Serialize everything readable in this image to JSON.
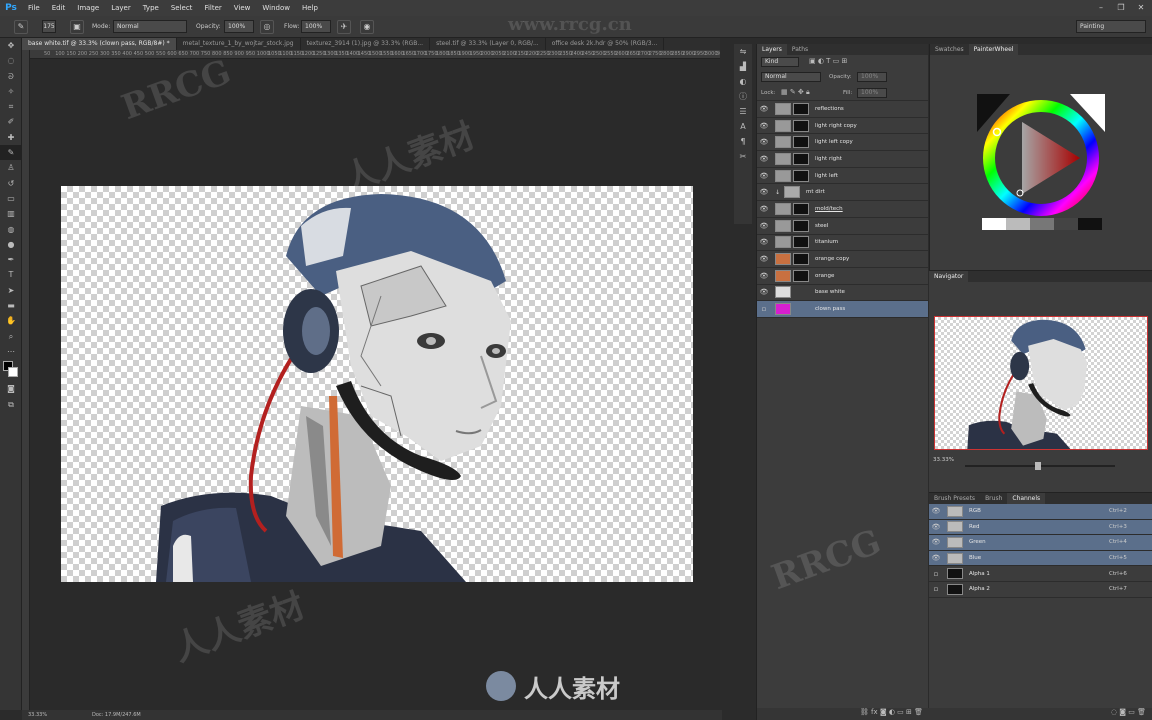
{
  "app": {
    "logo": "Ps"
  },
  "menu": [
    "File",
    "Edit",
    "Image",
    "Layer",
    "Type",
    "Select",
    "Filter",
    "View",
    "Window",
    "Help"
  ],
  "window_controls": [
    "–",
    "❐",
    "✕"
  ],
  "workspace": "Painting",
  "options": {
    "brush_size": "175",
    "mode_label": "Mode:",
    "mode_value": "Normal",
    "opacity_label": "Opacity:",
    "opacity_value": "100%",
    "flow_label": "Flow:",
    "flow_value": "100%"
  },
  "doc_tabs": [
    "base white.tif @ 33.3% (clown pass, RGB/8#) *",
    "metal_texture_1_by_wojtar_stock.jpg",
    "texturez_3914 (1).jpg @ 33.3% (RGB...",
    "steel.tif @ 33.3% (Layer 0, RGB/...",
    "office desk 2k.hdr @ 50% (RGB/3..."
  ],
  "ruler_ticks": [
    "50",
    "100",
    "150",
    "200",
    "250",
    "300",
    "350",
    "400",
    "450",
    "500",
    "550",
    "600",
    "650",
    "700",
    "750",
    "800",
    "850",
    "900",
    "950",
    "1000",
    "1050",
    "1100",
    "1150",
    "1200",
    "1250",
    "1300",
    "1350",
    "1400",
    "1450",
    "1500",
    "1550",
    "1600",
    "1650",
    "1700",
    "1750",
    "1800",
    "1850",
    "1900",
    "1950",
    "2000",
    "2050",
    "2100",
    "2150",
    "2200",
    "2250",
    "2300",
    "2350",
    "2400",
    "2450",
    "2500",
    "2550",
    "2600",
    "2650",
    "2700",
    "2750",
    "2800",
    "2850",
    "2900",
    "2950",
    "3000",
    "3050"
  ],
  "status": {
    "zoom": "33.33%",
    "doc": "Doc: 17.9M/247.6M"
  },
  "layers_panel": {
    "tabs": [
      "Layers",
      "Paths"
    ],
    "filter": "Kind",
    "blend": "Normal",
    "opacity_label": "Opacity:",
    "opacity": "100%",
    "lock_label": "Lock:",
    "fill_label": "Fill:",
    "fill": "100%",
    "layers": [
      {
        "name": "reflections"
      },
      {
        "name": "light right copy"
      },
      {
        "name": "light left copy"
      },
      {
        "name": "light right"
      },
      {
        "name": "light left"
      },
      {
        "name": "mt dirt"
      },
      {
        "name": "mold/tech"
      },
      {
        "name": "steel"
      },
      {
        "name": "titanium"
      },
      {
        "name": "orange copy"
      },
      {
        "name": "orange"
      },
      {
        "name": "base white"
      },
      {
        "name": "clown pass"
      }
    ]
  },
  "color_panel": {
    "tabs": [
      "Swatches",
      "PainterWheel"
    ]
  },
  "navigator": {
    "title": "Navigator",
    "zoom": "33.33%"
  },
  "channels_panel": {
    "tabs": [
      "Brush Presets",
      "Brush",
      "Channels"
    ],
    "channels": [
      {
        "name": "RGB",
        "key": "Ctrl+2"
      },
      {
        "name": "Red",
        "key": "Ctrl+3"
      },
      {
        "name": "Green",
        "key": "Ctrl+4"
      },
      {
        "name": "Blue",
        "key": "Ctrl+5"
      },
      {
        "name": "Alpha 1",
        "key": "Ctrl+6"
      },
      {
        "name": "Alpha 2",
        "key": "Ctrl+7"
      }
    ]
  },
  "watermarks": {
    "site": "www.rrcg.cn",
    "brand": "RRCG",
    "cn": "人人素材"
  }
}
